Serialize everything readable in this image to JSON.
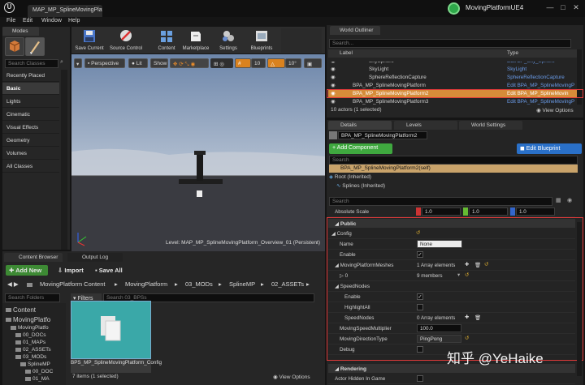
{
  "window": {
    "doc_tab": "MAP_MP_SplineMovingPlatform",
    "project": "MovingPlatformUE4",
    "logo": "U",
    "min": "—",
    "max": "□",
    "close": "✕"
  },
  "menu": [
    "File",
    "Edit",
    "Window",
    "Help"
  ],
  "modes": {
    "tab": "Modes",
    "search": "Search Classes",
    "categories": [
      "Recently Placed",
      "Basic",
      "Lights",
      "Cinematic",
      "Visual Effects",
      "Geometry",
      "Volumes",
      "All Classes"
    ]
  },
  "toolbar": [
    "Save Current",
    "Source Control",
    "Content",
    "Marketplace",
    "Settings",
    "Blueprints"
  ],
  "viewport": {
    "perspective": "Perspective",
    "lit": "Lit",
    "show": "Show",
    "grid": "10",
    "angle": "10°",
    "level": "Level:  MAP_MP_SplineMovingPlatform_Overview_01 (Persistent)"
  },
  "content_browser": {
    "tabs": [
      "Content Browser",
      "Output Log"
    ],
    "add_new": "Add New",
    "import": "Import",
    "save_all": "Save All",
    "breadcrumb": [
      "MovingPlatform Content",
      "MovingPlatform",
      "03_MODs",
      "SplineMP",
      "02_ASSETs"
    ],
    "search_folders": "Search Folders",
    "filters": "Filters",
    "search_assets": "Search 03_BPSs",
    "tree": [
      {
        "label": "Content",
        "indent": 0
      },
      {
        "label": "MovingPlatfo",
        "indent": 0
      },
      {
        "label": "MovingPlatfo",
        "indent": 1
      },
      {
        "label": "00_DOCs",
        "indent": 2
      },
      {
        "label": "01_MAPs",
        "indent": 2
      },
      {
        "label": "02_ASSETs",
        "indent": 2
      },
      {
        "label": "03_MODs",
        "indent": 2
      },
      {
        "label": "SplineMP",
        "indent": 3
      },
      {
        "label": "00_DOC",
        "indent": 4
      },
      {
        "label": "01_MA",
        "indent": 4
      }
    ],
    "asset_name": "BPS_MP_SplineMovingPlatform_Config",
    "status": "7 items (1 selected)",
    "view_options": "View Options"
  },
  "outliner": {
    "tab": "World Outliner",
    "search": "Search...",
    "col_label": "Label",
    "col_type": "Type",
    "rows": [
      {
        "label": "SkySphere",
        "type": "Edit BP_Sky_Sphere",
        "selected": false
      },
      {
        "label": "SkyLight",
        "type": "SkyLight",
        "selected": false
      },
      {
        "label": "SphereReflectionCapture",
        "type": "SphereReflectionCapture",
        "selected": false
      },
      {
        "label": "BPA_MP_SplineMovingPlatform",
        "type": "Edit BPA_MP_SplineMovingP",
        "selected": false
      },
      {
        "label": "BPA_MP_SplineMovingPlatform2",
        "type": "Edit BPA_MP_SplineMovin",
        "selected": true
      },
      {
        "label": "BPA_MP_SplineMovingPlatform3",
        "type": "Edit BPA_MP_SplineMovingP",
        "selected": false
      }
    ],
    "count": "10 actors (1 selected)",
    "view_options": "View Options"
  },
  "details": {
    "tabs": [
      "Details",
      "Levels",
      "World Settings"
    ],
    "actor_name": "BPA_MP_SplineMovingPlatform2",
    "add_component": "+ Add Component",
    "edit_blueprint": "Edit Blueprint",
    "search": "Search",
    "self_row": "BPA_MP_SplineMovingPlatform2(self)",
    "root": "Root (Inherited)",
    "splines": "Splines (Inherited)",
    "search2": "Search",
    "absolute_scale": {
      "label": "Absolute Scale",
      "x": "1.0",
      "y": "1.0",
      "z": "1.0"
    },
    "public": "Public",
    "config": "Config",
    "name": {
      "label": "Name",
      "value": "None"
    },
    "enable": {
      "label": "Enable",
      "checked": true
    },
    "meshes": {
      "label": "MovingPlatformMeshes",
      "value": "1 Array elements"
    },
    "mesh0": {
      "label": "0",
      "value": "9 members"
    },
    "speed_nodes": "SpeedNodes",
    "sn_enable": {
      "label": "Enable",
      "checked": true
    },
    "highlight": {
      "label": "HighlightAll",
      "checked": false
    },
    "sn_speednodes": {
      "label": "SpeedNodes",
      "value": "0 Array elements"
    },
    "multiplier": {
      "label": "MovingSpeedMultiplier",
      "value": "100.0"
    },
    "direction": {
      "label": "MovingDirectionType",
      "value": "PingPong"
    },
    "debug": {
      "label": "Debug",
      "checked": false
    },
    "rendering": "Rendering",
    "hidden_game": {
      "label": "Actor Hidden In Game",
      "checked": false
    }
  },
  "watermark": "知乎 @YeHaike",
  "colors": {
    "selection": "#d68c39",
    "highlight_box": "#e03a3a",
    "add_green": "#3fa83f",
    "edit_blue": "#2a70c8",
    "viewport_sky": "#6b84a8",
    "floor": "#3a3a3f"
  }
}
